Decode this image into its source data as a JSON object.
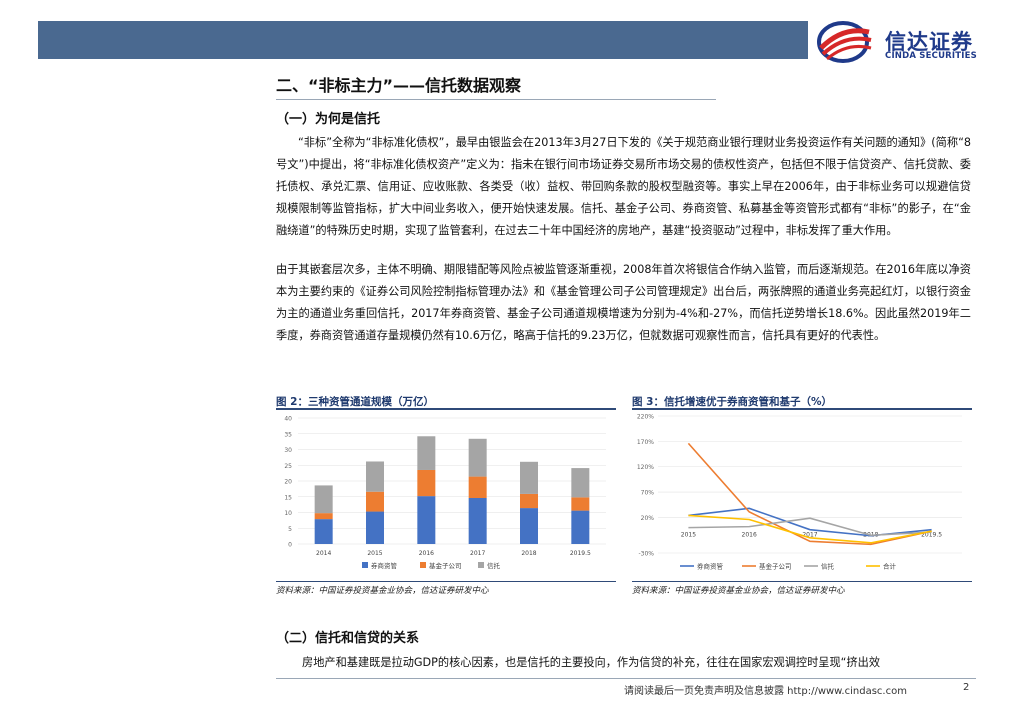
{
  "header": {
    "brand_cn": "信达证券",
    "brand_en": "CINDA SECURITIES",
    "bar_color": "#4a6990"
  },
  "section_title": "二、“非标主力”——信托数据观察",
  "sub1_title": "（一）为何是信托",
  "para1": "“非标”全称为“非标准化债权”，最早由银监会在2013年3月27日下发的《关于规范商业银行理财业务投资运作有关问题的通知》(简称“8号文”)中提出，将“非标准化债权资产”定义为：指未在银行间市场证券交易所市场交易的债权性资产，包括但不限于信贷资产、信托贷款、委托债权、承兑汇票、信用证、应收账款、各类受（收）益权、带回购条款的股权型融资等。事实上早在2006年，由于非标业务可以规避信贷规模限制等监管指标，扩大中间业务收入，便开始快速发展。信托、基金子公司、券商资管、私募基金等资管形式都有“非标”的影子，在“金融绕道”的特殊历史时期，实现了监管套利，在过去二十年中国经济的房地产，基建“投资驱动”过程中，非标发挥了重大作用。",
  "para2": "由于其嵌套层次多，主体不明确、期限错配等风险点被监管逐渐重视，2008年首次将银信合作纳入监管，而后逐渐规范。在2016年底以净资本为主要约束的《证券公司风险控制指标管理办法》和《基金管理公司子公司管理规定》出台后，两张牌照的通道业务亮起红灯，以银行资金为主的通道业务重回信托，2017年券商资管、基金子公司通道规模增速为分别为-4%和-27%，而信托逆势增长18.6%。因此虽然2019年二季度，券商资管通道存量规模仍然有10.6万亿，略高于信托的9.23万亿，但就数据可观察性而言，信托具有更好的代表性。",
  "figure2": {
    "title": "图 2：三种资管通道规模（万亿）",
    "source": "资料来源：中国证券投资基金业协会，信达证券研发中心"
  },
  "figure3": {
    "title": "图 3：信托增速优于券商资管和基子（%）",
    "source": "资料来源：中国证券投资基金业协会，信达证券研发中心"
  },
  "sub2_title": "（二）信托和信贷的关系",
  "para3": "房地产和基建既是拉动GDP的核心因素，也是信托的主要投向，作为信贷的补充，往往在国家宏观调控时呈现“挤出效",
  "footer": {
    "disclaimer": "请阅读最后一页免责声明及信息披露 http://www.cindasc.com",
    "page": "2"
  },
  "chart_data": [
    {
      "type": "bar",
      "stacked": true,
      "categories": [
        "2014",
        "2015",
        "2016",
        "2017",
        "2018",
        "2019.5"
      ],
      "series": [
        {
          "name": "券商资管",
          "values": [
            7.9,
            10.3,
            15.2,
            14.6,
            11.4,
            10.6
          ],
          "color": "#4472c4"
        },
        {
          "name": "基金子公司",
          "values": [
            1.9,
            6.3,
            8.3,
            6.8,
            4.5,
            4.2
          ],
          "color": "#ed7d31"
        },
        {
          "name": "信托",
          "values": [
            8.8,
            9.6,
            10.7,
            12.0,
            10.2,
            9.3
          ],
          "color": "#a5a5a5"
        }
      ],
      "ylim": [
        0,
        40
      ],
      "yticks": [
        0,
        5,
        10,
        15,
        20,
        25,
        30,
        35,
        40
      ],
      "legend_position": "bottom",
      "grid": true
    },
    {
      "type": "line",
      "categories": [
        "2015",
        "2016",
        "2017",
        "2018",
        "2019.5"
      ],
      "series": [
        {
          "name": "券商资管",
          "values": [
            24,
            38,
            -4,
            -16,
            -4
          ],
          "color": "#4472c4"
        },
        {
          "name": "基金子公司",
          "values": [
            166,
            31,
            -27,
            -33,
            -7
          ],
          "color": "#ed7d31"
        },
        {
          "name": "信托",
          "values": [
            0,
            2,
            18.6,
            -15,
            -9
          ],
          "color": "#a5a5a5"
        },
        {
          "name": "合计",
          "values": [
            24,
            16,
            -20,
            -30,
            -7
          ],
          "color": "#ffc000"
        }
      ],
      "ylim": [
        -50,
        220
      ],
      "yticks": [
        -50,
        20,
        70,
        120,
        170,
        220
      ],
      "ytick_labels": [
        "-30%",
        "20%",
        "70%",
        "120%",
        "170%",
        "220%"
      ],
      "legend_position": "bottom",
      "grid": true
    }
  ]
}
